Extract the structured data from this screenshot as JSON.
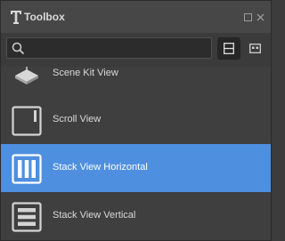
{
  "window": {
    "title": "Toolbox",
    "title_icon": "text-tool-icon"
  },
  "search": {
    "value": "",
    "placeholder": ""
  },
  "toolbar": {
    "list_view_icon": "list-view-icon",
    "grid_view_icon": "grid-view-icon"
  },
  "items": [
    {
      "label": "Scene Kit View",
      "icon": "scene-kit-view-icon",
      "selected": false
    },
    {
      "label": "Scroll View",
      "icon": "scroll-view-icon",
      "selected": false
    },
    {
      "label": "Stack View Horizontal",
      "icon": "stack-view-horizontal-icon",
      "selected": true
    },
    {
      "label": "Stack View Vertical",
      "icon": "stack-view-vertical-icon",
      "selected": false
    }
  ],
  "colors": {
    "selection": "#4f8fe0",
    "background": "#3f3f3f",
    "text": "#d9d9d9"
  }
}
